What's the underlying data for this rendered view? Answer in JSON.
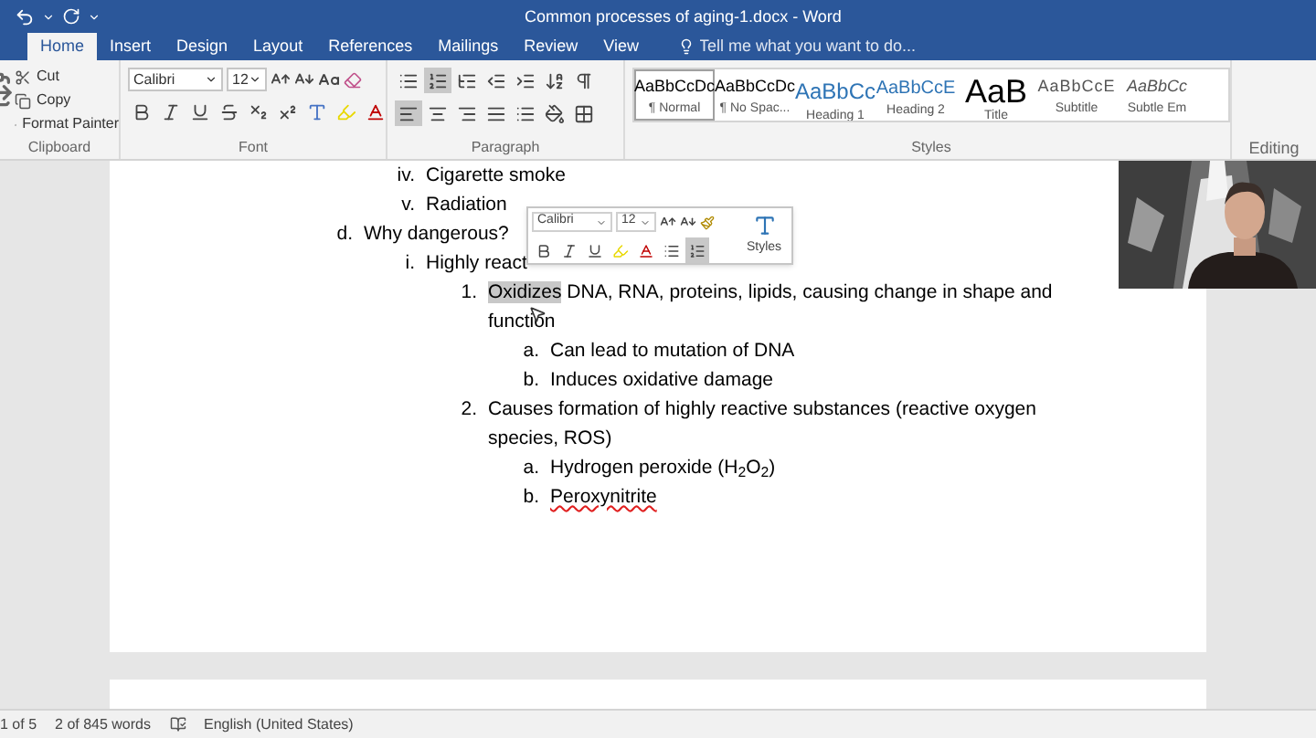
{
  "window": {
    "title": "Common processes of aging-1.docx - Word"
  },
  "tabs": [
    {
      "label": "Home",
      "selected": true
    },
    {
      "label": "Insert",
      "selected": false
    },
    {
      "label": "Design",
      "selected": false
    },
    {
      "label": "Layout",
      "selected": false
    },
    {
      "label": "References",
      "selected": false
    },
    {
      "label": "Mailings",
      "selected": false
    },
    {
      "label": "Review",
      "selected": false
    },
    {
      "label": "View",
      "selected": false
    }
  ],
  "tell_me": {
    "placeholder": "Tell me what you want to do..."
  },
  "clipboard": {
    "buttons": [
      {
        "kind": "cut",
        "label": "Cut"
      },
      {
        "kind": "copy",
        "label": "Copy"
      },
      {
        "kind": "painter",
        "label": "Format Painter"
      }
    ],
    "group_label": "Clipboard"
  },
  "font": {
    "font_name": "Calibri",
    "font_size": "12",
    "group_label": "Font",
    "buttons": [
      {
        "kind": "bold",
        "on": false
      },
      {
        "kind": "italic",
        "on": false
      },
      {
        "kind": "underline",
        "on": false
      },
      {
        "kind": "strike",
        "on": false
      },
      {
        "kind": "sub",
        "on": false
      },
      {
        "kind": "sup",
        "on": false
      },
      {
        "kind": "effects",
        "on": false
      },
      {
        "kind": "highlight",
        "on": false
      },
      {
        "kind": "color",
        "on": false
      }
    ]
  },
  "paragraph": {
    "group_label": "Paragraph",
    "row1": [
      {
        "kind": "bullets",
        "on": false
      },
      {
        "kind": "numbering",
        "on": true
      },
      {
        "kind": "multilevel",
        "on": false
      },
      {
        "kind": "outdent",
        "on": false
      },
      {
        "kind": "indent",
        "on": false
      },
      {
        "kind": "sort",
        "on": false
      },
      {
        "kind": "marks",
        "on": false
      }
    ],
    "row2": [
      {
        "kind": "left",
        "on": true
      },
      {
        "kind": "center",
        "on": false
      },
      {
        "kind": "right",
        "on": false
      },
      {
        "kind": "justify",
        "on": false
      },
      {
        "kind": "spacing",
        "on": false
      },
      {
        "kind": "shading",
        "on": false
      },
      {
        "kind": "borders",
        "on": false
      }
    ]
  },
  "styles": {
    "group_label": "Styles",
    "items": [
      {
        "preview": "AaBbCcDc",
        "label": "¶ Normal",
        "kind": "plain",
        "selected": true
      },
      {
        "preview": "AaBbCcDc",
        "label": "¶ No Spac...",
        "kind": "plain",
        "selected": false
      },
      {
        "preview": "AaBbCc",
        "label": "Heading 1",
        "kind": "heading1",
        "selected": false
      },
      {
        "preview": "AaBbCcE",
        "label": "Heading 2",
        "kind": "heading2",
        "selected": false
      },
      {
        "preview": "AaB",
        "label": "Title",
        "kind": "title",
        "selected": false
      },
      {
        "preview": "AaBbCcE",
        "label": "Subtitle",
        "kind": "subtitle",
        "selected": false
      },
      {
        "preview": "AaBbCc",
        "label": "Subtle Em",
        "kind": "emphasis",
        "selected": false
      }
    ]
  },
  "editing": {
    "group_label": "Editing"
  },
  "outline": [
    {
      "children": [
        {
          "marker": "iv.",
          "text": "Cigarette smoke"
        },
        {
          "marker": "v.",
          "text": "Radiation"
        }
      ]
    },
    {
      "marker": "d.",
      "text": "Why dangerous?",
      "children": [
        {
          "marker": "i.",
          "text": "Highly react",
          "children": [
            {
              "marker": "1.",
              "highlighted": "Oxidizes",
              "text": " DNA, RNA, proteins, lipids, causing change in shape and function",
              "children": [
                {
                  "marker": "a.",
                  "text": "Can lead to mutation of DNA"
                },
                {
                  "marker": "b.",
                  "text": "Induces oxidative damage"
                }
              ]
            },
            {
              "marker": "2.",
              "text": "Causes formation of highly reactive substances (reactive oxygen species, ROS)",
              "children": [
                {
                  "marker": "a.",
                  "text": "Hydrogen peroxide (H$_{2}$O$_{2}$)"
                },
                {
                  "marker": "b.",
                  "text": "Peroxynitrite",
                  "spelling_error": true
                }
              ]
            }
          ]
        }
      ]
    }
  ],
  "mini_toolbar": {
    "font_name": "Calibri",
    "font_size": "12",
    "styles_label": "Styles",
    "buttons": [
      {
        "kind": "bold",
        "on": false
      },
      {
        "kind": "italic",
        "on": false
      },
      {
        "kind": "underline",
        "on": false
      },
      {
        "kind": "highlight",
        "on": false
      },
      {
        "kind": "color",
        "on": false
      },
      {
        "kind": "bullets",
        "on": false
      },
      {
        "kind": "numbering",
        "on": true
      }
    ]
  },
  "status_bar": {
    "page": "1 of 5",
    "words": "2 of 845 words",
    "language": "English (United States)"
  }
}
